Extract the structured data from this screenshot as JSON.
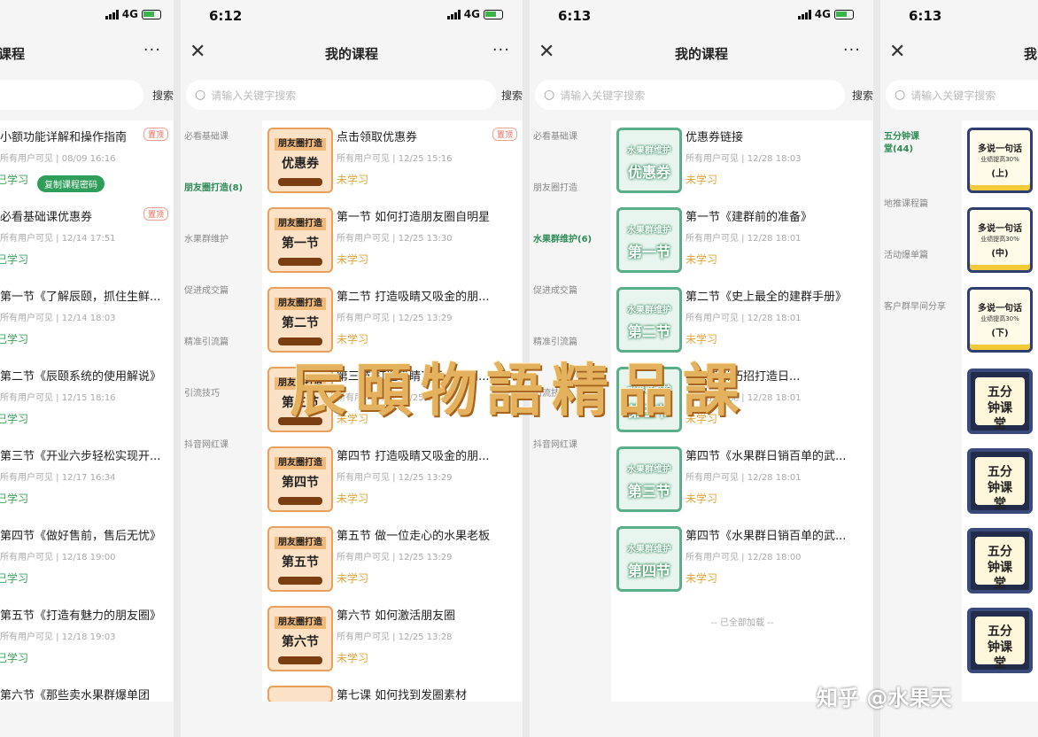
{
  "phone1": {
    "title": "课程",
    "more": "···",
    "search_btn": "搜索",
    "items": [
      {
        "title": "小额功能详解和操作指南",
        "meta": "所有用户可见 | 08/09 16:16",
        "status": "已学习",
        "tag": "置顶",
        "action": "复制课程密码"
      },
      {
        "title": "必看基础课优惠券",
        "meta": "所有用户可见 | 12/14 17:51",
        "status": "已学习",
        "tag": "置顶"
      },
      {
        "title": "第一节《了解辰颐，抓住生鲜...",
        "meta": "所有用户可见 | 12/14 18:03",
        "status": "已学习"
      },
      {
        "title": "第二节《辰颐系统的使用解说》",
        "meta": "所有用户可见 | 12/15 18:16",
        "status": "已学习"
      },
      {
        "title": "第三节《开业六步轻松实现开...",
        "meta": "所有用户可见 | 12/17 16:34",
        "status": "已学习"
      },
      {
        "title": "第四节《做好售前，售后无忧》",
        "meta": "所有用户可见 | 12/18 19:00",
        "status": "已学习"
      },
      {
        "title": "第五节《打造有魅力的朋友圈》",
        "meta": "所有用户可见 | 12/18 19:03",
        "status": "已学习"
      },
      {
        "title": "第六节《那些卖水果群爆单团",
        "meta": "",
        "status": ""
      }
    ]
  },
  "phone2": {
    "time": "6:12",
    "signal": "4G",
    "title": "我的课程",
    "more": "···",
    "search_placeholder": "请输入关键字搜索",
    "search_btn": "搜索",
    "sidebar": [
      "必看基础课",
      "朋友圈打造(8)",
      "水果群维护",
      "促进成交篇",
      "精准引流篇",
      "引流技巧",
      "抖音网红课"
    ],
    "thumb_head": "朋友圈打造",
    "items": [
      {
        "title": "点击领取优惠券",
        "meta": "所有用户可见 | 12/25 15:16",
        "status": "未学习",
        "tag": "置顶",
        "thumb": "优惠券"
      },
      {
        "title": "第一节 如何打造朋友圈自明星",
        "meta": "所有用户可见 | 12/25 13:30",
        "status": "未学习",
        "thumb": "第一节"
      },
      {
        "title": "第二节 打造吸睛又吸金的朋...",
        "meta": "所有用户可见 | 12/25 13:29",
        "status": "未学习",
        "thumb": "第二节"
      },
      {
        "title": "第三节 打造吸睛又吸金的朋...",
        "meta": "所有用户可见 | 12/25 13:29",
        "status": "未学习",
        "thumb": "第三节"
      },
      {
        "title": "第四节 打造吸睛又吸金的朋...",
        "meta": "所有用户可见 | 12/25 13:29",
        "status": "未学习",
        "thumb": "第四节"
      },
      {
        "title": "第五节 做一位走心的水果老板",
        "meta": "所有用户可见 | 12/25 13:29",
        "status": "未学习",
        "thumb": "第五节"
      },
      {
        "title": "第六节 如何激活朋友圈",
        "meta": "所有用户可见 | 12/25 13:28",
        "status": "未学习",
        "thumb": "第六节"
      },
      {
        "title": "第七课 如何找到发圈素材",
        "meta": "",
        "status": "",
        "thumb": ""
      }
    ]
  },
  "phone3": {
    "time": "6:13",
    "signal": "4G",
    "title": "我的课程",
    "more": "···",
    "search_placeholder": "请输入关键字搜索",
    "search_btn": "搜索",
    "sidebar": [
      "必看基础课",
      "朋友圈打造",
      "水果群维护(6)",
      "促进成交篇",
      "精准引流篇",
      "引流技巧",
      "抖音网红课"
    ],
    "thumb_head": "水果群维护",
    "items": [
      {
        "title": "优惠券链接",
        "meta": "所有用户可见 | 12/28 18:03",
        "status": "未学习",
        "thumb": "优惠券"
      },
      {
        "title": "第一节《建群前的准备》",
        "meta": "所有用户可见 | 12/28 18:01",
        "status": "未学习",
        "thumb": "第一节"
      },
      {
        "title": "第二节《史上最全的建群手册》",
        "meta": "所有用户可见 | 12/28 18:01",
        "status": "未学习",
        "thumb": "第二节"
      },
      {
        "title": "第三节《巧招打造日...",
        "meta": "所有用户可见 | 12/28 18:01",
        "status": "未学习",
        "thumb": "第三节"
      },
      {
        "title": "第四节《水果群日销百单的武...",
        "meta": "所有用户可见 | 12/28 18:01",
        "status": "未学习",
        "thumb": "第三节"
      },
      {
        "title": "第四节《水果群日销百单的武...",
        "meta": "所有用户可见 | 12/28 18:00",
        "status": "未学习",
        "thumb": "第四节"
      }
    ],
    "loaded": "-- 已全部加载 --"
  },
  "phone4": {
    "time": "6:13",
    "title": "我的课程",
    "search_placeholder": "请输入关键字搜索",
    "sidebar": [
      "五分钟课堂(44)",
      "地推课程篇",
      "活动爆单篇",
      "客户群早间分享"
    ],
    "thumbs": [
      {
        "head": "多说一句话",
        "sub": "业绩提高30%",
        "big": "(上)"
      },
      {
        "head": "多说一句话",
        "sub": "业绩提高30%",
        "big": "(中)"
      },
      {
        "head": "多说一句话",
        "sub": "业绩提高30%",
        "big": "(下)"
      }
    ],
    "dark_thumb": "五分钟课堂"
  },
  "watermark": "辰頤物語精品課",
  "zhihu": "知乎 @水果天"
}
